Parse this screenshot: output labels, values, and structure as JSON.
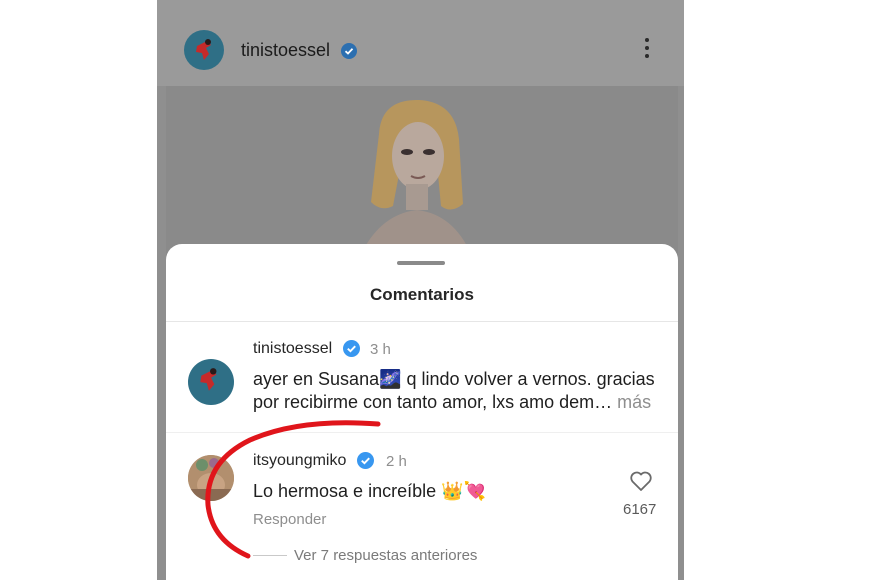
{
  "post": {
    "username": "tinistoessel",
    "verified_icon": "verified-badge-icon",
    "menu_icon": "more-vertical-icon"
  },
  "sheet": {
    "title": "Comentarios"
  },
  "comments": [
    {
      "username": "tinistoessel",
      "time": "3 h",
      "text_line1": "ayer en Susana🌌 q lindo volver a vernos. gracias",
      "text_line2": "por recibirme con tanto amor, lxs amo dem…",
      "more": "más"
    },
    {
      "username": "itsyoungmiko",
      "time": "2 h",
      "text": "Lo hermosa e increíble 👑💘",
      "reply": "Responder",
      "likes": "6167",
      "view_replies": "Ver 7 respuestas anteriores"
    }
  ],
  "colors": {
    "verified": "#3897f0",
    "annotation_stroke": "#e0151b"
  }
}
